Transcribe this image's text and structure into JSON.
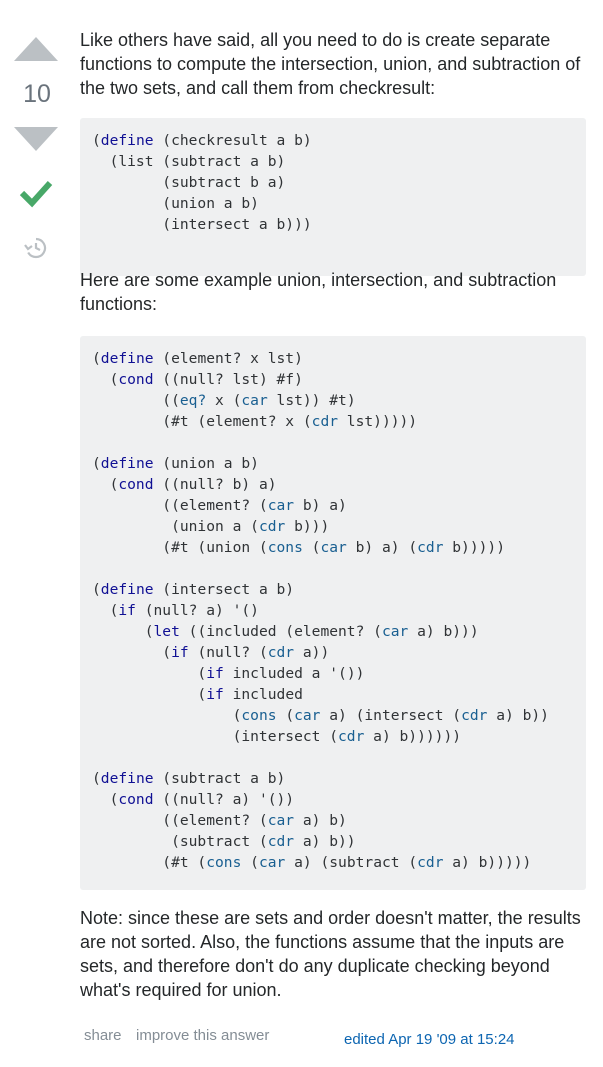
{
  "vote": {
    "count": "10",
    "up_icon": "arrow-up-icon",
    "down_icon": "arrow-down-icon",
    "accepted_icon": "checkmark-icon",
    "history_icon": "history-icon",
    "accepted_color": "#48a868",
    "arrow_color": "#bbc0c4"
  },
  "answer": {
    "intro": "Like others have said, all you need to do is create separate functions to compute the intersection, union, and subtraction of the two sets, and call them from checkresult:",
    "code1": "(define (checkresult a b)\n  (list (subtract a b)\n        (subtract b a)\n        (union a b)\n        (intersect a b)))",
    "middle": "Here are some example union, intersection, and subtraction functions:",
    "code2": "(define (element? x lst)\n  (cond ((null? lst) #f)\n        ((eq? x (car lst)) #t)\n        (#t (element? x (cdr lst)))))\n\n(define (union a b)\n  (cond ((null? b) a)\n        ((element? (car b) a)\n         (union a (cdr b)))\n        (#t (union (cons (car b) a) (cdr b)))))\n\n(define (intersect a b)\n  (if (null? a) '()\n      (let ((included (element? (car a) b)))\n        (if (null? (cdr a))\n            (if included a '())\n            (if included\n                (cons (car a) (intersect (cdr a) b))\n                (intersect (cdr a) b))))))\n\n(define (subtract a b)\n  (cond ((null? a) '())\n        ((element? (car a) b)\n         (subtract (cdr a) b))\n        (#t (cons (car a) (subtract (cdr a) b)))))",
    "note": "Note: since these are sets and order doesn't matter, the results are not sorted. Also, the functions assume that the inputs are sets, and therefore don't do any duplicate checking beyond what's required for union."
  },
  "footer": {
    "share": "share",
    "improve": "improve this answer",
    "edited": "edited Apr 19 '09 at 15:24"
  }
}
